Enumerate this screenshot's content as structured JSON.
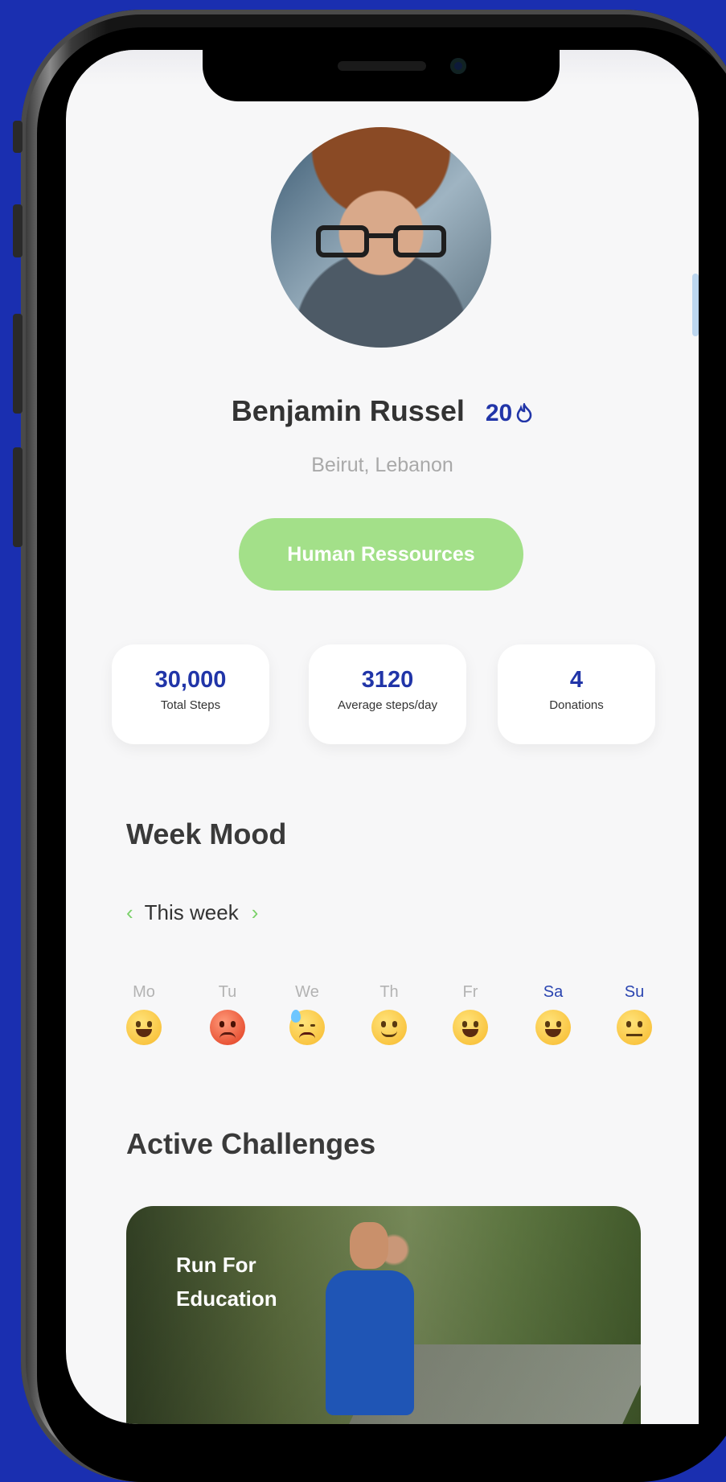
{
  "profile": {
    "name": "Benjamin Russel",
    "score": "20",
    "location": "Beirut, Lebanon",
    "department": "Human Ressources"
  },
  "stats": [
    {
      "value": "30,000",
      "label": "Total Steps"
    },
    {
      "value": "3120",
      "label": "Average steps/day"
    },
    {
      "value": "4",
      "label": "Donations"
    }
  ],
  "mood": {
    "title": "Week Mood",
    "period": "This week",
    "days": [
      {
        "label": "Mo",
        "mood": "grinning-face"
      },
      {
        "label": "Tu",
        "mood": "angry-face"
      },
      {
        "label": "We",
        "mood": "downcast-sweat-face"
      },
      {
        "label": "Th",
        "mood": "slightly-smiling-face"
      },
      {
        "label": "Fr",
        "mood": "grinning-face"
      },
      {
        "label": "Sa",
        "mood": "grinning-face"
      },
      {
        "label": "Su",
        "mood": "neutral-face"
      }
    ]
  },
  "challenges": {
    "title": "Active Challenges",
    "items": [
      {
        "title": "Run For Education"
      }
    ]
  },
  "colors": {
    "accent": "#2135a8",
    "green": "#a3e089",
    "background": "#1a2fb0"
  }
}
